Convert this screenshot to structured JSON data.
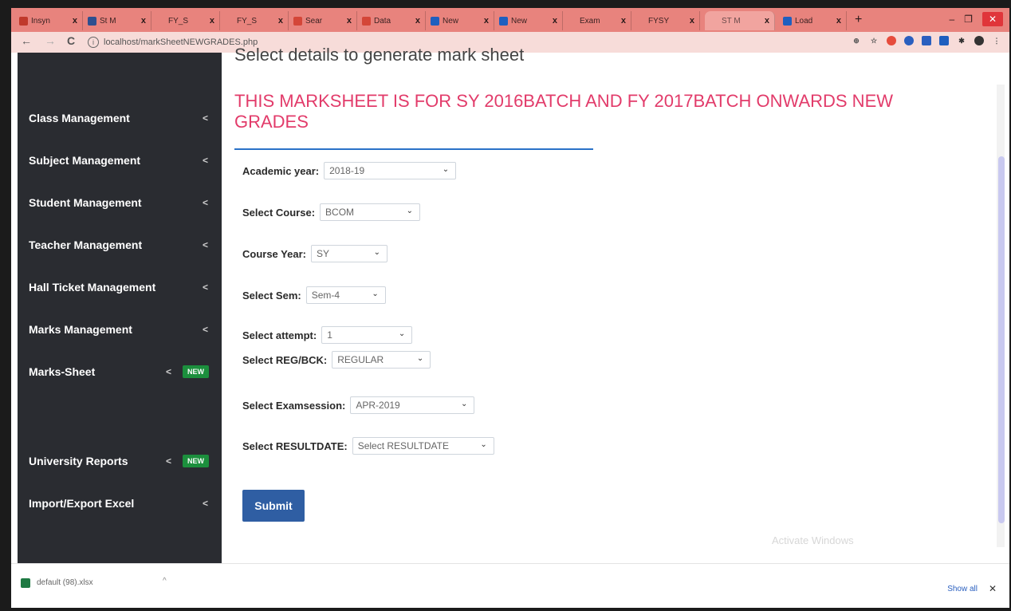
{
  "browser": {
    "tabs": [
      {
        "label": "Insyn",
        "close": "x",
        "fav": "#c0392b",
        "active": false
      },
      {
        "label": "St M",
        "close": "x",
        "fav": "#2f4f8f",
        "active": false
      },
      {
        "label": "FY_S",
        "close": "x",
        "fav": "#e8837d",
        "active": false
      },
      {
        "label": "FY_S",
        "close": "x",
        "fav": "#e8837d",
        "active": false
      },
      {
        "label": "Sear",
        "close": "x",
        "fav": "#d44638",
        "active": false
      },
      {
        "label": "Data",
        "close": "x",
        "fav": "#d44638",
        "active": false
      },
      {
        "label": "New",
        "close": "x",
        "fav": "#1f5fbf",
        "active": false
      },
      {
        "label": "New",
        "close": "x",
        "fav": "#1f5fbf",
        "active": false
      },
      {
        "label": "Exam",
        "close": "x",
        "fav": "#e8837d",
        "active": false
      },
      {
        "label": "FYSY",
        "close": "x",
        "fav": "#e8837d",
        "active": false
      },
      {
        "label": "ST M",
        "close": "x",
        "fav": "#f1a49f",
        "active": true
      },
      {
        "label": "Load",
        "close": "x",
        "fav": "#1f5fbf",
        "active": false
      }
    ],
    "new_tab": "+",
    "window": {
      "minimize": "–",
      "restore": "❐",
      "close": "✕"
    },
    "url": "localhost/markSheetNEWGRADES.php",
    "nav": {
      "back": "←",
      "forward": "→",
      "reload": "C"
    }
  },
  "sidebar": {
    "items": [
      {
        "label": "Class Management",
        "chev": "<",
        "badge": ""
      },
      {
        "label": "Subject Management",
        "chev": "<",
        "badge": ""
      },
      {
        "label": "Student Management",
        "chev": "<",
        "badge": ""
      },
      {
        "label": "Teacher Management",
        "chev": "<",
        "badge": ""
      },
      {
        "label": "Hall Ticket Management",
        "chev": "<",
        "badge": ""
      },
      {
        "label": "Marks Management",
        "chev": "<",
        "badge": ""
      },
      {
        "label": "Marks-Sheet",
        "chev": "<",
        "badge": "NEW"
      },
      {
        "label": "University Reports",
        "chev": "<",
        "badge": "NEW"
      },
      {
        "label": "Import/Export Excel",
        "chev": "<",
        "badge": ""
      }
    ]
  },
  "main": {
    "heading": "Select details to generate mark sheet",
    "notice": "THIS MARKSHEET IS FOR SY 2016BATCH AND FY 2017BATCH ONWARDS NEW GRADES",
    "form": {
      "academic_year": {
        "label": "Academic year:",
        "value": "2018-19"
      },
      "course": {
        "label": "Select Course:",
        "value": "BCOM"
      },
      "course_year": {
        "label": "Course Year:",
        "value": "SY"
      },
      "sem": {
        "label": "Select Sem:",
        "value": "Sem-4"
      },
      "attempt": {
        "label": "Select attempt:",
        "value": "1"
      },
      "reg_bck": {
        "label": "Select REG/BCK:",
        "value": "REGULAR"
      },
      "examsession": {
        "label": "Select Examsession:",
        "value": "APR-2019"
      },
      "resultdate": {
        "label": "Select RESULTDATE:",
        "value": "Select RESULTDATE"
      }
    },
    "submit_label": "Submit",
    "watermark": "Activate Windows"
  },
  "downloads": {
    "file": "default (98).xlsx",
    "chev": "^",
    "show_all": "Show all",
    "close": "✕"
  }
}
